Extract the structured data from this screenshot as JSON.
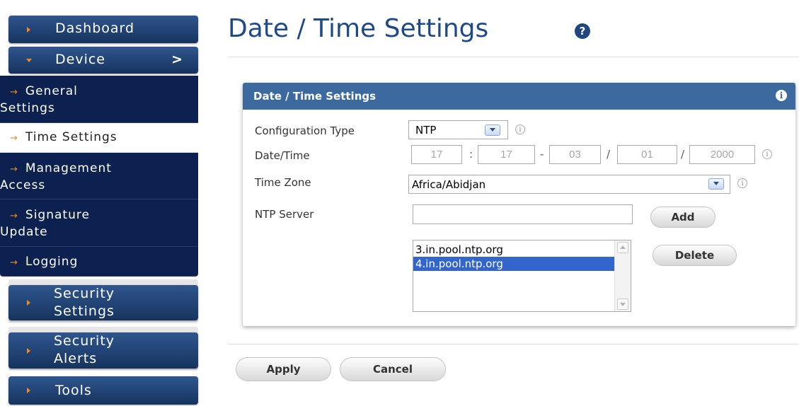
{
  "sidebar": {
    "dashboard": "Dashboard",
    "device": "Device",
    "device_chevron": ">",
    "sub_items": [
      {
        "line1": "General",
        "line2": "Settings"
      },
      {
        "line1": "Time Settings"
      },
      {
        "line1": "Management",
        "line2": "Access"
      },
      {
        "line1": "Signature",
        "line2": "Update"
      },
      {
        "line1": "Logging"
      }
    ],
    "security_settings": {
      "line1": "Security",
      "line2": "Settings"
    },
    "security_alerts": {
      "line1": "Security",
      "line2": "Alerts"
    },
    "tools": "Tools"
  },
  "page": {
    "title": "Date / Time Settings",
    "help_icon": "?"
  },
  "panel": {
    "title": "Date / Time Settings",
    "info_icon": "i",
    "config_type_label": "Configuration Type",
    "config_type_value": "NTP",
    "datetime_label": "Date/Time",
    "datetime": {
      "hour": "17",
      "minute": "17",
      "month": "03",
      "day": "01",
      "year": "2000"
    },
    "datetime_seps": [
      ":",
      "-",
      "/",
      "/"
    ],
    "timezone_label": "Time Zone",
    "timezone_value": "Africa/Abidjan",
    "ntp_label": "NTP Server",
    "ntp_value": "",
    "add_button": "Add",
    "delete_button": "Delete",
    "ntp_servers": [
      "3.in.pool.ntp.org",
      "4.in.pool.ntp.org"
    ],
    "selected_server_index": 1
  },
  "actions": {
    "apply": "Apply",
    "cancel": "Cancel"
  },
  "colors": {
    "accent": "#1f4a87",
    "nav_dark": "#0d2150",
    "bullet": "#ef8a1e",
    "panel_header": "#3d6a9e",
    "selection": "#3366cc"
  }
}
